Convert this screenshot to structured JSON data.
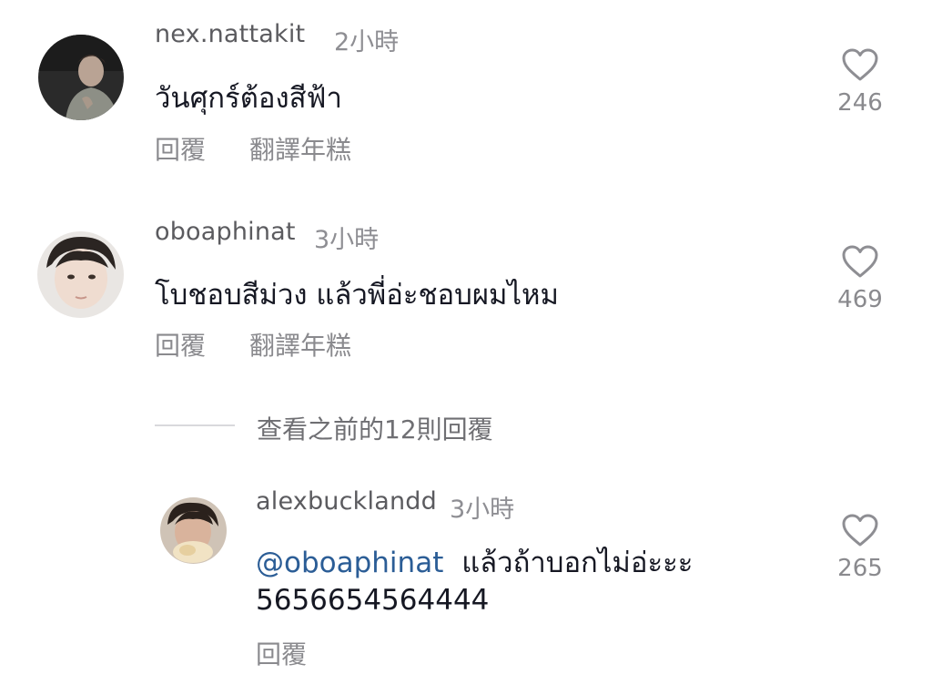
{
  "comments": [
    {
      "username": "nex.nattakit",
      "time": "2小時",
      "text": "วันศุกร์ต้องสีฟ้า",
      "likes": "246",
      "actions": {
        "reply": "回覆",
        "translate": "翻譯年糕"
      },
      "icons": {
        "like": "heart-outline-icon"
      }
    },
    {
      "username": "oboaphinat",
      "time": "3小時",
      "text": "โบชอบสีม่วง แล้วพี่อ่ะชอบผมไหม",
      "likes": "469",
      "actions": {
        "reply": "回覆",
        "translate": "翻譯年糕"
      },
      "icons": {
        "like": "heart-outline-icon"
      }
    }
  ],
  "view_previous_replies": "查看之前的12則回覆",
  "reply": {
    "username": "alexbucklandd",
    "time": "3小時",
    "mention": "@oboaphinat",
    "text_line1": "แล้วถ้าบอกไม่อ่ะะะ",
    "text_line2": "5656654564444",
    "likes": "265",
    "actions": {
      "reply": "回覆"
    },
    "icons": {
      "like": "heart-outline-icon"
    }
  },
  "colors": {
    "mention": "#2b5d96",
    "secondary_text": "#8a8a8e",
    "primary_text": "#161823"
  }
}
